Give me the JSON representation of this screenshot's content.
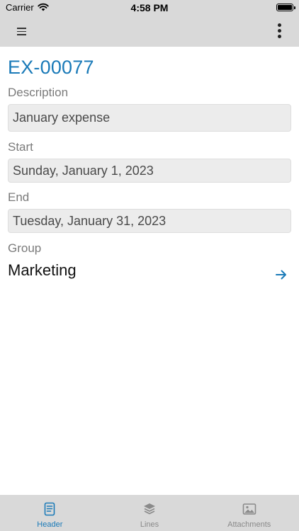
{
  "status_bar": {
    "carrier": "Carrier",
    "time": "4:58 PM"
  },
  "toolbar": {
    "menu_icon": "hamburger-menu-icon",
    "more_icon": "more-vertical-icon"
  },
  "record": {
    "id": "EX-00077",
    "description_label": "Description",
    "description_value": "January expense",
    "start_label": "Start",
    "start_value": "Sunday, January 1, 2023",
    "end_label": "End",
    "end_value": "Tuesday, January 31, 2023",
    "group_label": "Group",
    "group_value": "Marketing",
    "group_nav_icon": "arrow-right-icon"
  },
  "tabs": [
    {
      "label": "Header",
      "icon": "document-icon",
      "active": true
    },
    {
      "label": "Lines",
      "icon": "layers-icon",
      "active": false
    },
    {
      "label": "Attachments",
      "icon": "image-icon",
      "active": false
    }
  ],
  "colors": {
    "accent": "#1a7ab8",
    "bar_background": "#d9d9d9",
    "field_background": "#ececec",
    "label_gray": "#7a7a7a",
    "inactive_tab": "#8a8a8a"
  }
}
